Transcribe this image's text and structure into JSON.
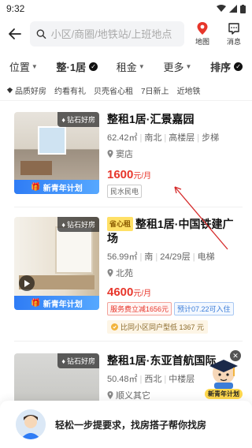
{
  "status": {
    "time": "9:32"
  },
  "header": {
    "search_placeholder": "小区/商圈/地铁站/上班地点",
    "map_label": "地图",
    "message_label": "消息"
  },
  "filters": [
    {
      "label": "位置"
    },
    {
      "label": "整·1居"
    },
    {
      "label": "租金"
    },
    {
      "label": "更多"
    },
    {
      "label": "排序"
    }
  ],
  "tags": [
    "品质好房",
    "约看有礼",
    "贝壳省心租",
    "7日新上",
    "近地铁"
  ],
  "listings": [
    {
      "title": "整租1居·汇景嘉园",
      "area": "62.42㎡",
      "orientation": "南北",
      "floor": "高楼层",
      "elevator": "步梯",
      "location": "窦店",
      "price": "1600",
      "price_unit": "元/月",
      "gem_label": "钻石好房",
      "promo_label": "新青年计划",
      "chips": [
        "民水民电"
      ]
    },
    {
      "badge": "省心租",
      "title": "整租1居·中国铁建广场",
      "area": "56.99㎡",
      "orientation": "南",
      "floor": "24/29层",
      "elevator": "电梯",
      "location": "北苑",
      "price": "4600",
      "price_unit": "元/月",
      "gem_label": "钻石好房",
      "promo_label": "新青年计划",
      "chips": [
        "服务费立减1656元",
        "预计07.22可入住"
      ],
      "compare": "比同小区同户型低 1367 元"
    },
    {
      "title": "整租1居·东亚首航国际",
      "area": "50.48㎡",
      "orientation": "西北",
      "floor": "中楼层",
      "location": "顺义其它",
      "gem_label": "钻石好房"
    }
  ],
  "float_promo_label": "新青年计划",
  "bottom_banner_text": "轻松一步提要求，找房搭子帮你找房",
  "colors": {
    "price": "#e7362b",
    "promo": "#2f7cf5",
    "map_pin": "#e7362b"
  }
}
